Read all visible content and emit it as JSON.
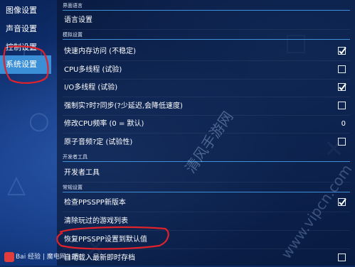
{
  "sidebar": {
    "items": [
      {
        "label": "图像设置"
      },
      {
        "label": "声音设置"
      },
      {
        "label": "控制设置"
      },
      {
        "label": "系统设置"
      }
    ]
  },
  "sections": [
    {
      "header": "界面语言",
      "rows": [
        {
          "label": "语言设置"
        }
      ]
    },
    {
      "header": "模拟设置",
      "rows": [
        {
          "label": "快速内存访问 (不稳定)",
          "checked": true
        },
        {
          "label": "CPU多线程 (试验)",
          "checked": false
        },
        {
          "label": "I/O多线程 (试验)",
          "checked": true
        },
        {
          "label": "强制实?时?同步(?少延迟,会降低速度)",
          "checked": false
        },
        {
          "label": "修改CPU频率 (0 = 默认)",
          "value": "0"
        },
        {
          "label": "原子音频?定 (试验性)",
          "checked": false
        }
      ]
    },
    {
      "header": "开发者工具",
      "rows": [
        {
          "label": "开发者工具"
        }
      ]
    },
    {
      "header": "常规设置",
      "rows": [
        {
          "label": "检查PPSSPP新版本",
          "checked": true
        },
        {
          "label": "清除玩过的游戏列表"
        },
        {
          "label": "恢复PPSSPP设置到默认值"
        },
        {
          "label": "自动载入最新即时存档",
          "checked": false
        }
      ]
    }
  ],
  "watermark": {
    "text1": "清风手游网",
    "text2": "www.vipcn.com"
  },
  "logo": {
    "text": "Bai 经验 | 魔电网 | 吧"
  },
  "colors": {
    "accent": "#3a8fd6",
    "highlight": "#e0222a"
  }
}
